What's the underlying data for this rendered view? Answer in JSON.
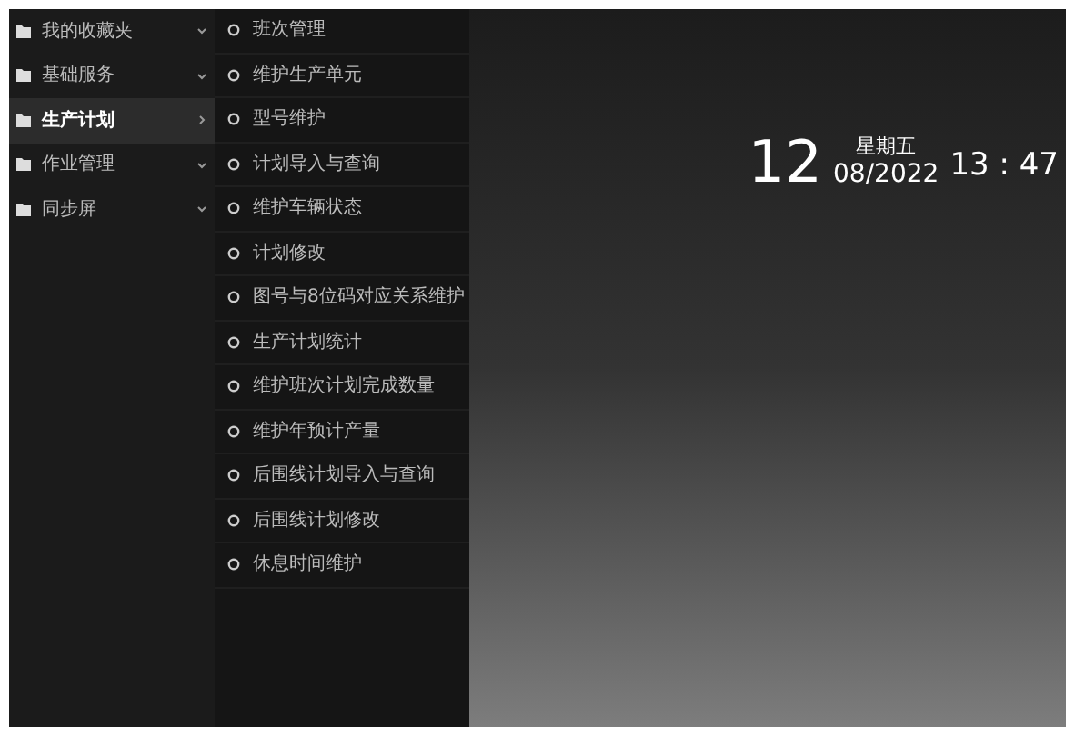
{
  "sidebar": {
    "items": [
      {
        "label": "我的收藏夹",
        "expanded": false,
        "selected": false
      },
      {
        "label": "基础服务",
        "expanded": false,
        "selected": false
      },
      {
        "label": "生产计划",
        "expanded": true,
        "selected": true
      },
      {
        "label": "作业管理",
        "expanded": false,
        "selected": false
      },
      {
        "label": "同步屏",
        "expanded": false,
        "selected": false
      }
    ]
  },
  "submenu": {
    "items": [
      {
        "label": "班次管理"
      },
      {
        "label": "维护生产单元"
      },
      {
        "label": "型号维护"
      },
      {
        "label": "计划导入与查询"
      },
      {
        "label": "维护车辆状态"
      },
      {
        "label": "计划修改"
      },
      {
        "label": "图号与8位码对应关系维护"
      },
      {
        "label": "生产计划统计"
      },
      {
        "label": "维护班次计划完成数量"
      },
      {
        "label": "维护年预计产量"
      },
      {
        "label": "后围线计划导入与查询"
      },
      {
        "label": "后围线计划修改"
      },
      {
        "label": "休息时间维护"
      }
    ]
  },
  "clock": {
    "day": "12",
    "weekday": "星期五",
    "month_year": "08/2022",
    "time": "13 : 47"
  }
}
